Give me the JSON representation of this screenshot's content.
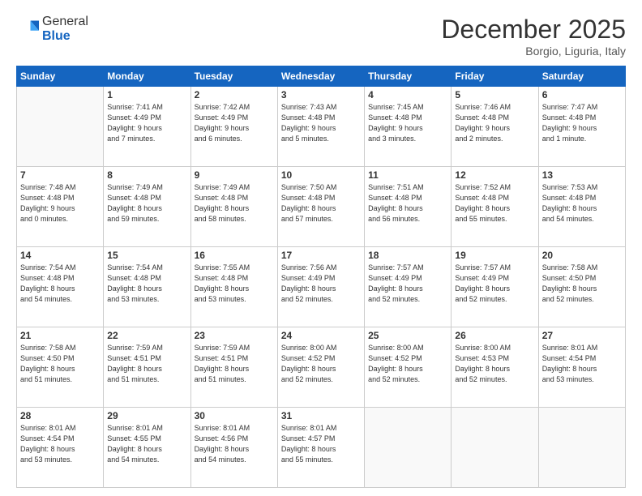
{
  "logo": {
    "general": "General",
    "blue": "Blue"
  },
  "header": {
    "month": "December 2025",
    "location": "Borgio, Liguria, Italy"
  },
  "weekdays": [
    "Sunday",
    "Monday",
    "Tuesday",
    "Wednesday",
    "Thursday",
    "Friday",
    "Saturday"
  ],
  "weeks": [
    [
      {
        "day": "",
        "info": ""
      },
      {
        "day": "1",
        "info": "Sunrise: 7:41 AM\nSunset: 4:49 PM\nDaylight: 9 hours\nand 7 minutes."
      },
      {
        "day": "2",
        "info": "Sunrise: 7:42 AM\nSunset: 4:49 PM\nDaylight: 9 hours\nand 6 minutes."
      },
      {
        "day": "3",
        "info": "Sunrise: 7:43 AM\nSunset: 4:48 PM\nDaylight: 9 hours\nand 5 minutes."
      },
      {
        "day": "4",
        "info": "Sunrise: 7:45 AM\nSunset: 4:48 PM\nDaylight: 9 hours\nand 3 minutes."
      },
      {
        "day": "5",
        "info": "Sunrise: 7:46 AM\nSunset: 4:48 PM\nDaylight: 9 hours\nand 2 minutes."
      },
      {
        "day": "6",
        "info": "Sunrise: 7:47 AM\nSunset: 4:48 PM\nDaylight: 9 hours\nand 1 minute."
      }
    ],
    [
      {
        "day": "7",
        "info": "Sunrise: 7:48 AM\nSunset: 4:48 PM\nDaylight: 9 hours\nand 0 minutes."
      },
      {
        "day": "8",
        "info": "Sunrise: 7:49 AM\nSunset: 4:48 PM\nDaylight: 8 hours\nand 59 minutes."
      },
      {
        "day": "9",
        "info": "Sunrise: 7:49 AM\nSunset: 4:48 PM\nDaylight: 8 hours\nand 58 minutes."
      },
      {
        "day": "10",
        "info": "Sunrise: 7:50 AM\nSunset: 4:48 PM\nDaylight: 8 hours\nand 57 minutes."
      },
      {
        "day": "11",
        "info": "Sunrise: 7:51 AM\nSunset: 4:48 PM\nDaylight: 8 hours\nand 56 minutes."
      },
      {
        "day": "12",
        "info": "Sunrise: 7:52 AM\nSunset: 4:48 PM\nDaylight: 8 hours\nand 55 minutes."
      },
      {
        "day": "13",
        "info": "Sunrise: 7:53 AM\nSunset: 4:48 PM\nDaylight: 8 hours\nand 54 minutes."
      }
    ],
    [
      {
        "day": "14",
        "info": "Sunrise: 7:54 AM\nSunset: 4:48 PM\nDaylight: 8 hours\nand 54 minutes."
      },
      {
        "day": "15",
        "info": "Sunrise: 7:54 AM\nSunset: 4:48 PM\nDaylight: 8 hours\nand 53 minutes."
      },
      {
        "day": "16",
        "info": "Sunrise: 7:55 AM\nSunset: 4:48 PM\nDaylight: 8 hours\nand 53 minutes."
      },
      {
        "day": "17",
        "info": "Sunrise: 7:56 AM\nSunset: 4:49 PM\nDaylight: 8 hours\nand 52 minutes."
      },
      {
        "day": "18",
        "info": "Sunrise: 7:57 AM\nSunset: 4:49 PM\nDaylight: 8 hours\nand 52 minutes."
      },
      {
        "day": "19",
        "info": "Sunrise: 7:57 AM\nSunset: 4:49 PM\nDaylight: 8 hours\nand 52 minutes."
      },
      {
        "day": "20",
        "info": "Sunrise: 7:58 AM\nSunset: 4:50 PM\nDaylight: 8 hours\nand 52 minutes."
      }
    ],
    [
      {
        "day": "21",
        "info": "Sunrise: 7:58 AM\nSunset: 4:50 PM\nDaylight: 8 hours\nand 51 minutes."
      },
      {
        "day": "22",
        "info": "Sunrise: 7:59 AM\nSunset: 4:51 PM\nDaylight: 8 hours\nand 51 minutes."
      },
      {
        "day": "23",
        "info": "Sunrise: 7:59 AM\nSunset: 4:51 PM\nDaylight: 8 hours\nand 51 minutes."
      },
      {
        "day": "24",
        "info": "Sunrise: 8:00 AM\nSunset: 4:52 PM\nDaylight: 8 hours\nand 52 minutes."
      },
      {
        "day": "25",
        "info": "Sunrise: 8:00 AM\nSunset: 4:52 PM\nDaylight: 8 hours\nand 52 minutes."
      },
      {
        "day": "26",
        "info": "Sunrise: 8:00 AM\nSunset: 4:53 PM\nDaylight: 8 hours\nand 52 minutes."
      },
      {
        "day": "27",
        "info": "Sunrise: 8:01 AM\nSunset: 4:54 PM\nDaylight: 8 hours\nand 53 minutes."
      }
    ],
    [
      {
        "day": "28",
        "info": "Sunrise: 8:01 AM\nSunset: 4:54 PM\nDaylight: 8 hours\nand 53 minutes."
      },
      {
        "day": "29",
        "info": "Sunrise: 8:01 AM\nSunset: 4:55 PM\nDaylight: 8 hours\nand 54 minutes."
      },
      {
        "day": "30",
        "info": "Sunrise: 8:01 AM\nSunset: 4:56 PM\nDaylight: 8 hours\nand 54 minutes."
      },
      {
        "day": "31",
        "info": "Sunrise: 8:01 AM\nSunset: 4:57 PM\nDaylight: 8 hours\nand 55 minutes."
      },
      {
        "day": "",
        "info": ""
      },
      {
        "day": "",
        "info": ""
      },
      {
        "day": "",
        "info": ""
      }
    ]
  ]
}
